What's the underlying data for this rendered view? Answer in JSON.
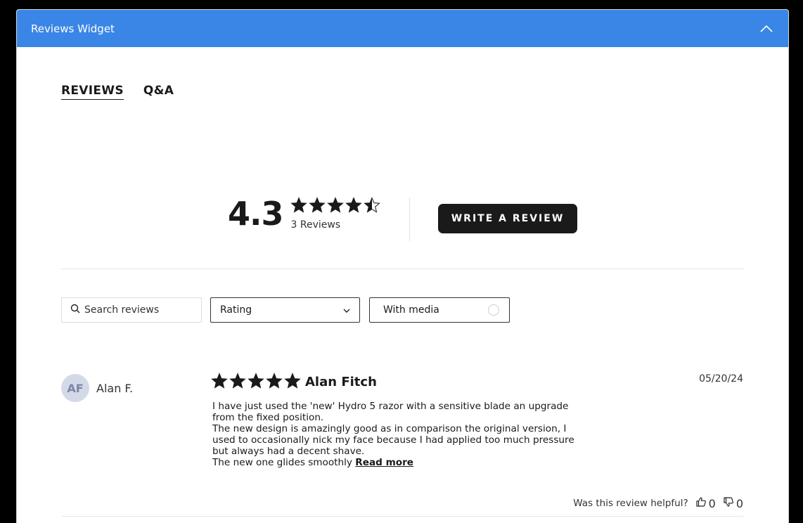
{
  "header": {
    "title": "Reviews Widget"
  },
  "tabs": [
    {
      "label": "REVIEWS",
      "active": true
    },
    {
      "label": "Q&A",
      "active": false
    }
  ],
  "summary": {
    "average": "4.3",
    "stars": 4.3,
    "count_label": "3 Reviews",
    "write_button": "WRITE A REVIEW"
  },
  "filters": {
    "search_placeholder": "Search reviews",
    "rating_select": "Rating",
    "media_toggle": "With media"
  },
  "review": {
    "initials": "AF",
    "author": "Alan F.",
    "stars": 5,
    "title": "Alan Fitch",
    "date": "05/20/24",
    "body_lines": [
      "I have just used the 'new' Hydro 5 razor with a sensitive blade an upgrade from the fixed position.",
      "The new design is amazingly good as in comparison the original version, I used to occasionally nick my face because I had applied too much pressure but always had a decent shave.",
      "The new one glides smoothly"
    ],
    "read_more": "Read more",
    "helpful_label": "Was this review helpful?",
    "upvotes": "0",
    "downvotes": "0"
  },
  "colors": {
    "header": "#3a86e6",
    "button": "#1a1a1a",
    "avatar_bg": "#d4d9e8"
  }
}
